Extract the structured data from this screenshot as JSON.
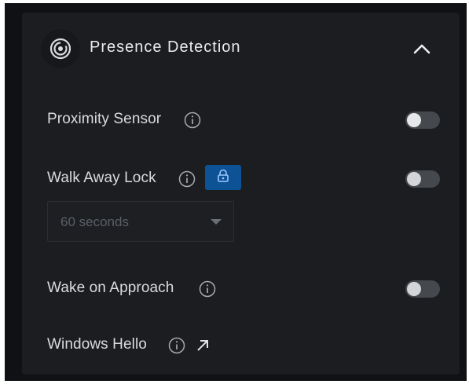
{
  "header": {
    "title": "Presence Detection",
    "icon": "presence-sensor-icon",
    "collapse_icon": "chevron-up-icon"
  },
  "settings": {
    "proximity_sensor": {
      "label": "Proximity Sensor",
      "enabled": false
    },
    "walk_away_lock": {
      "label": "Walk Away Lock",
      "enabled": false,
      "badge_icon": "lock-icon",
      "timeout": {
        "selected": "60 seconds"
      }
    },
    "wake_on_approach": {
      "label": "Wake on Approach",
      "enabled": false
    },
    "windows_hello": {
      "label": "Windows Hello",
      "link_icon": "external-link-arrow-icon"
    }
  },
  "colors": {
    "background": "#0f1114",
    "panel": "#1b1d21",
    "badge": "#0e5296",
    "toggle_track": "#45484d"
  }
}
